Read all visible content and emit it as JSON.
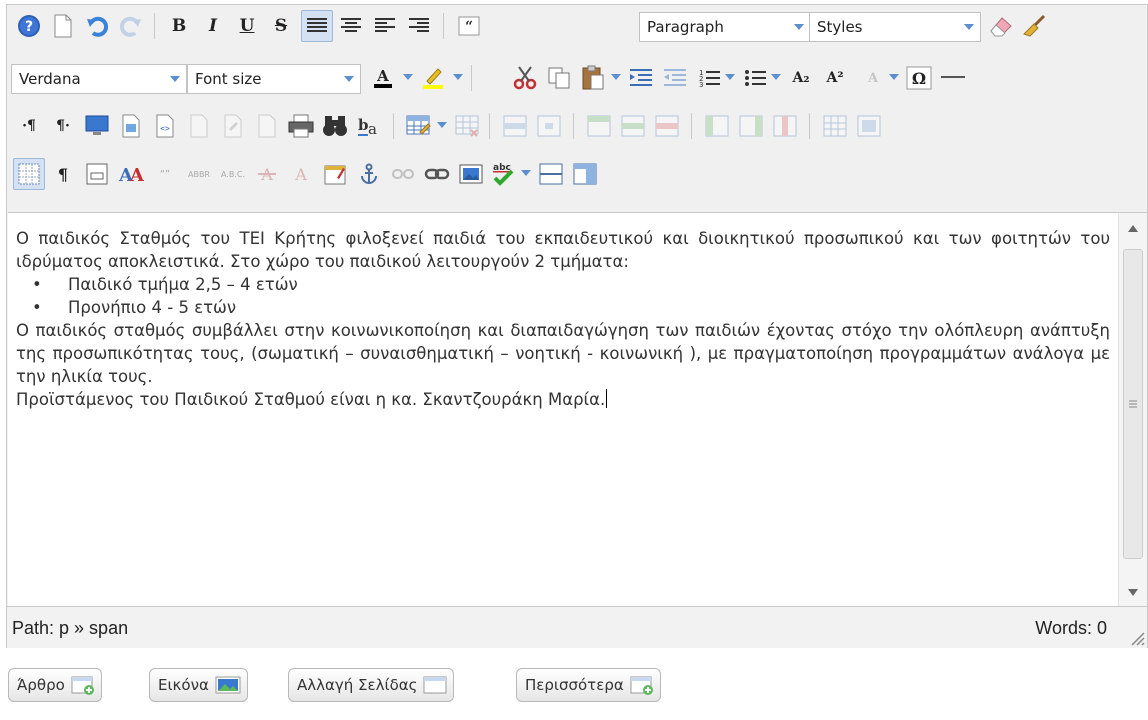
{
  "toolbar": {
    "block_format": {
      "selected": "Paragraph"
    },
    "styles": {
      "selected": "Styles"
    },
    "font_family": {
      "selected": "Verdana"
    },
    "font_size": {
      "selected": "Font size"
    },
    "text_color": "#000000",
    "highlight_color": "#ffff00",
    "accent_color": "#5b8fcf",
    "superscript_label": "A²",
    "subscript_label": "A₂",
    "omega_label": "Ω",
    "direction_ltr_label": "·¶",
    "direction_rtl_label": "¶·",
    "pilcrow_label": "¶",
    "spell_label": "abc",
    "insert_quote_label": "“”",
    "abbr_label": "ABBR",
    "acronym_label": "A.B.C."
  },
  "content": {
    "paragraph1": "Ο παιδικός Σταθμός του ΤΕΙ Κρήτης φιλοξενεί παιδιά του εκπαιδευτικού και διοικητικού προσωπικού και των φοιτητών του ιδρύματος αποκλειστικά. Στο χώρο του παιδικού λειτουργούν 2 τμήματα:",
    "bullets": [
      "Παιδικό τμήμα 2,5 – 4 ετών",
      "Προνήπιο 4 - 5 ετών"
    ],
    "paragraph2": "Ο παιδικός σταθμός συμβάλλει στην κοινωνικοποίηση και διαπαιδαγώγηση των παιδιών έχοντας στόχο την ολόπλευρη ανάπτυξη της προσωπικότητας τους, (σωματική – συναισθηματική – νοητική - κοινωνική ), με πραγματοποίηση προγραμμάτων ανάλογα με την ηλικία τους.",
    "paragraph3": "Προϊστάμενος του Παιδικού Σταθμού είναι η κα. Σκαντζουράκη Μαρία."
  },
  "status": {
    "path": "Path: p » span",
    "words": "Words: 0"
  },
  "buttons": {
    "article": "Άρθρο",
    "image": "Εικόνα",
    "pagebreak": "Αλλαγή Σελίδας",
    "readmore": "Περισσότερα"
  }
}
